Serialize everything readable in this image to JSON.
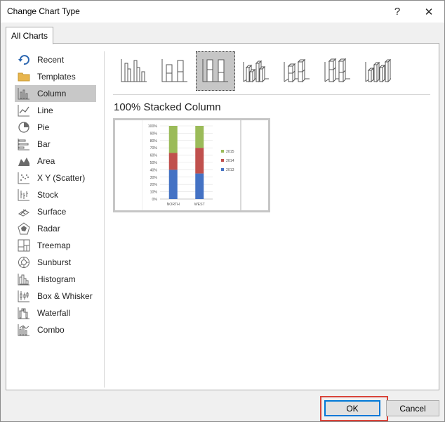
{
  "window": {
    "title": "Change Chart Type",
    "help_glyph": "?",
    "close_glyph": "✕"
  },
  "tabs": [
    {
      "label": "All Charts",
      "selected": true
    }
  ],
  "sidebar": {
    "selected": "Column",
    "items": [
      {
        "label": "Recent",
        "icon": "recent-icon"
      },
      {
        "label": "Templates",
        "icon": "templates-folder-icon"
      },
      {
        "label": "Column",
        "icon": "column-chart-icon"
      },
      {
        "label": "Line",
        "icon": "line-chart-icon"
      },
      {
        "label": "Pie",
        "icon": "pie-chart-icon"
      },
      {
        "label": "Bar",
        "icon": "bar-chart-icon"
      },
      {
        "label": "Area",
        "icon": "area-chart-icon"
      },
      {
        "label": "X Y (Scatter)",
        "icon": "scatter-chart-icon"
      },
      {
        "label": "Stock",
        "icon": "stock-chart-icon"
      },
      {
        "label": "Surface",
        "icon": "surface-chart-icon"
      },
      {
        "label": "Radar",
        "icon": "radar-chart-icon"
      },
      {
        "label": "Treemap",
        "icon": "treemap-chart-icon"
      },
      {
        "label": "Sunburst",
        "icon": "sunburst-chart-icon"
      },
      {
        "label": "Histogram",
        "icon": "histogram-chart-icon"
      },
      {
        "label": "Box & Whisker",
        "icon": "box-whisker-chart-icon"
      },
      {
        "label": "Waterfall",
        "icon": "waterfall-chart-icon"
      },
      {
        "label": "Combo",
        "icon": "combo-chart-icon"
      }
    ]
  },
  "subtypes": {
    "selected_index": 2,
    "items": [
      {
        "icon": "clustered-column-icon"
      },
      {
        "icon": "stacked-column-icon"
      },
      {
        "icon": "100-stacked-column-icon"
      },
      {
        "icon": "3d-clustered-column-icon"
      },
      {
        "icon": "3d-stacked-column-icon"
      },
      {
        "icon": "3d-100-stacked-column-icon"
      },
      {
        "icon": "3d-column-icon"
      }
    ]
  },
  "selected_subtype_title": "100% Stacked Column",
  "colors": {
    "series_2013": "#4472c4",
    "series_2014": "#c0504d",
    "series_2015": "#9bbb59",
    "ok_focus": "#0078d7",
    "highlight": "#d9443a"
  },
  "chart_data": {
    "type": "bar",
    "stacked": "100%",
    "categories": [
      "NORTH",
      "WEST"
    ],
    "series": [
      {
        "name": "2013",
        "values": [
          40,
          35
        ]
      },
      {
        "name": "2014",
        "values": [
          23,
          35
        ]
      },
      {
        "name": "2015",
        "values": [
          37,
          30
        ]
      }
    ],
    "yticks": [
      "0%",
      "10%",
      "20%",
      "30%",
      "40%",
      "50%",
      "60%",
      "70%",
      "80%",
      "90%",
      "100%"
    ],
    "ylim": [
      0,
      100
    ],
    "legend": [
      "2015",
      "2014",
      "2013"
    ],
    "legend_position": "right",
    "grid": true
  },
  "buttons": {
    "ok": "OK",
    "cancel": "Cancel"
  }
}
